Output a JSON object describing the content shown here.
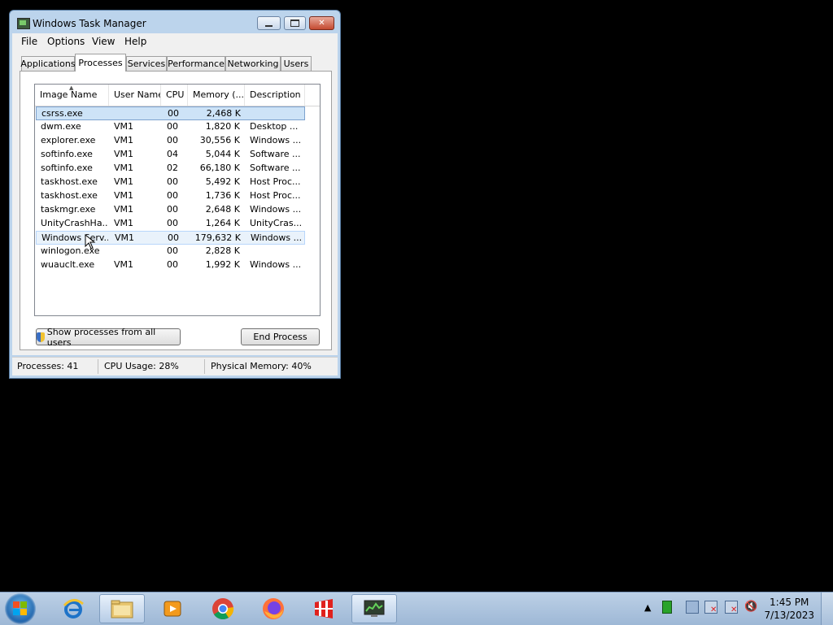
{
  "window": {
    "title": "Windows Task Manager",
    "buttons": {
      "minimize": "—",
      "maximize": "▭",
      "close": "✕"
    }
  },
  "menu": [
    "File",
    "Options",
    "View",
    "Help"
  ],
  "tabs": [
    "Applications",
    "Processes",
    "Services",
    "Performance",
    "Networking",
    "Users"
  ],
  "active_tab": "Processes",
  "columns": [
    "Image Name",
    "User Name",
    "CPU",
    "Memory (...",
    "Description"
  ],
  "processes": [
    {
      "name": "csrss.exe",
      "user": "",
      "cpu": "00",
      "mem": "2,468 K",
      "desc": ""
    },
    {
      "name": "dwm.exe",
      "user": "VM1",
      "cpu": "00",
      "mem": "1,820 K",
      "desc": "Desktop ..."
    },
    {
      "name": "explorer.exe",
      "user": "VM1",
      "cpu": "00",
      "mem": "30,556 K",
      "desc": "Windows ..."
    },
    {
      "name": "softinfo.exe",
      "user": "VM1",
      "cpu": "04",
      "mem": "5,044 K",
      "desc": "Software ..."
    },
    {
      "name": "softinfo.exe",
      "user": "VM1",
      "cpu": "02",
      "mem": "66,180 K",
      "desc": "Software ..."
    },
    {
      "name": "taskhost.exe",
      "user": "VM1",
      "cpu": "00",
      "mem": "5,492 K",
      "desc": "Host Proc..."
    },
    {
      "name": "taskhost.exe",
      "user": "VM1",
      "cpu": "00",
      "mem": "1,736 K",
      "desc": "Host Proc..."
    },
    {
      "name": "taskmgr.exe",
      "user": "VM1",
      "cpu": "00",
      "mem": "2,648 K",
      "desc": "Windows ..."
    },
    {
      "name": "UnityCrashHa...",
      "user": "VM1",
      "cpu": "00",
      "mem": "1,264 K",
      "desc": "UnityCras..."
    },
    {
      "name": "Windows Serv...",
      "user": "VM1",
      "cpu": "00",
      "mem": "179,632 K",
      "desc": "Windows ..."
    },
    {
      "name": "winlogon.exe",
      "user": "",
      "cpu": "00",
      "mem": "2,828 K",
      "desc": ""
    },
    {
      "name": "wuauclt.exe",
      "user": "VM1",
      "cpu": "00",
      "mem": "1,992 K",
      "desc": "Windows ..."
    }
  ],
  "buttons": {
    "show_all": "Show processes from all users",
    "end_process": "End Process"
  },
  "status": {
    "processes": "Processes: 41",
    "cpu": "CPU Usage: 28%",
    "memory": "Physical Memory: 40%"
  },
  "taskbar": {
    "apps": [
      "internet-explorer-icon",
      "file-explorer-icon",
      "media-player-icon",
      "chrome-icon",
      "firefox-icon",
      "office-icon",
      "task-manager-icon"
    ],
    "time": "1:45 PM",
    "date": "7/13/2023"
  }
}
